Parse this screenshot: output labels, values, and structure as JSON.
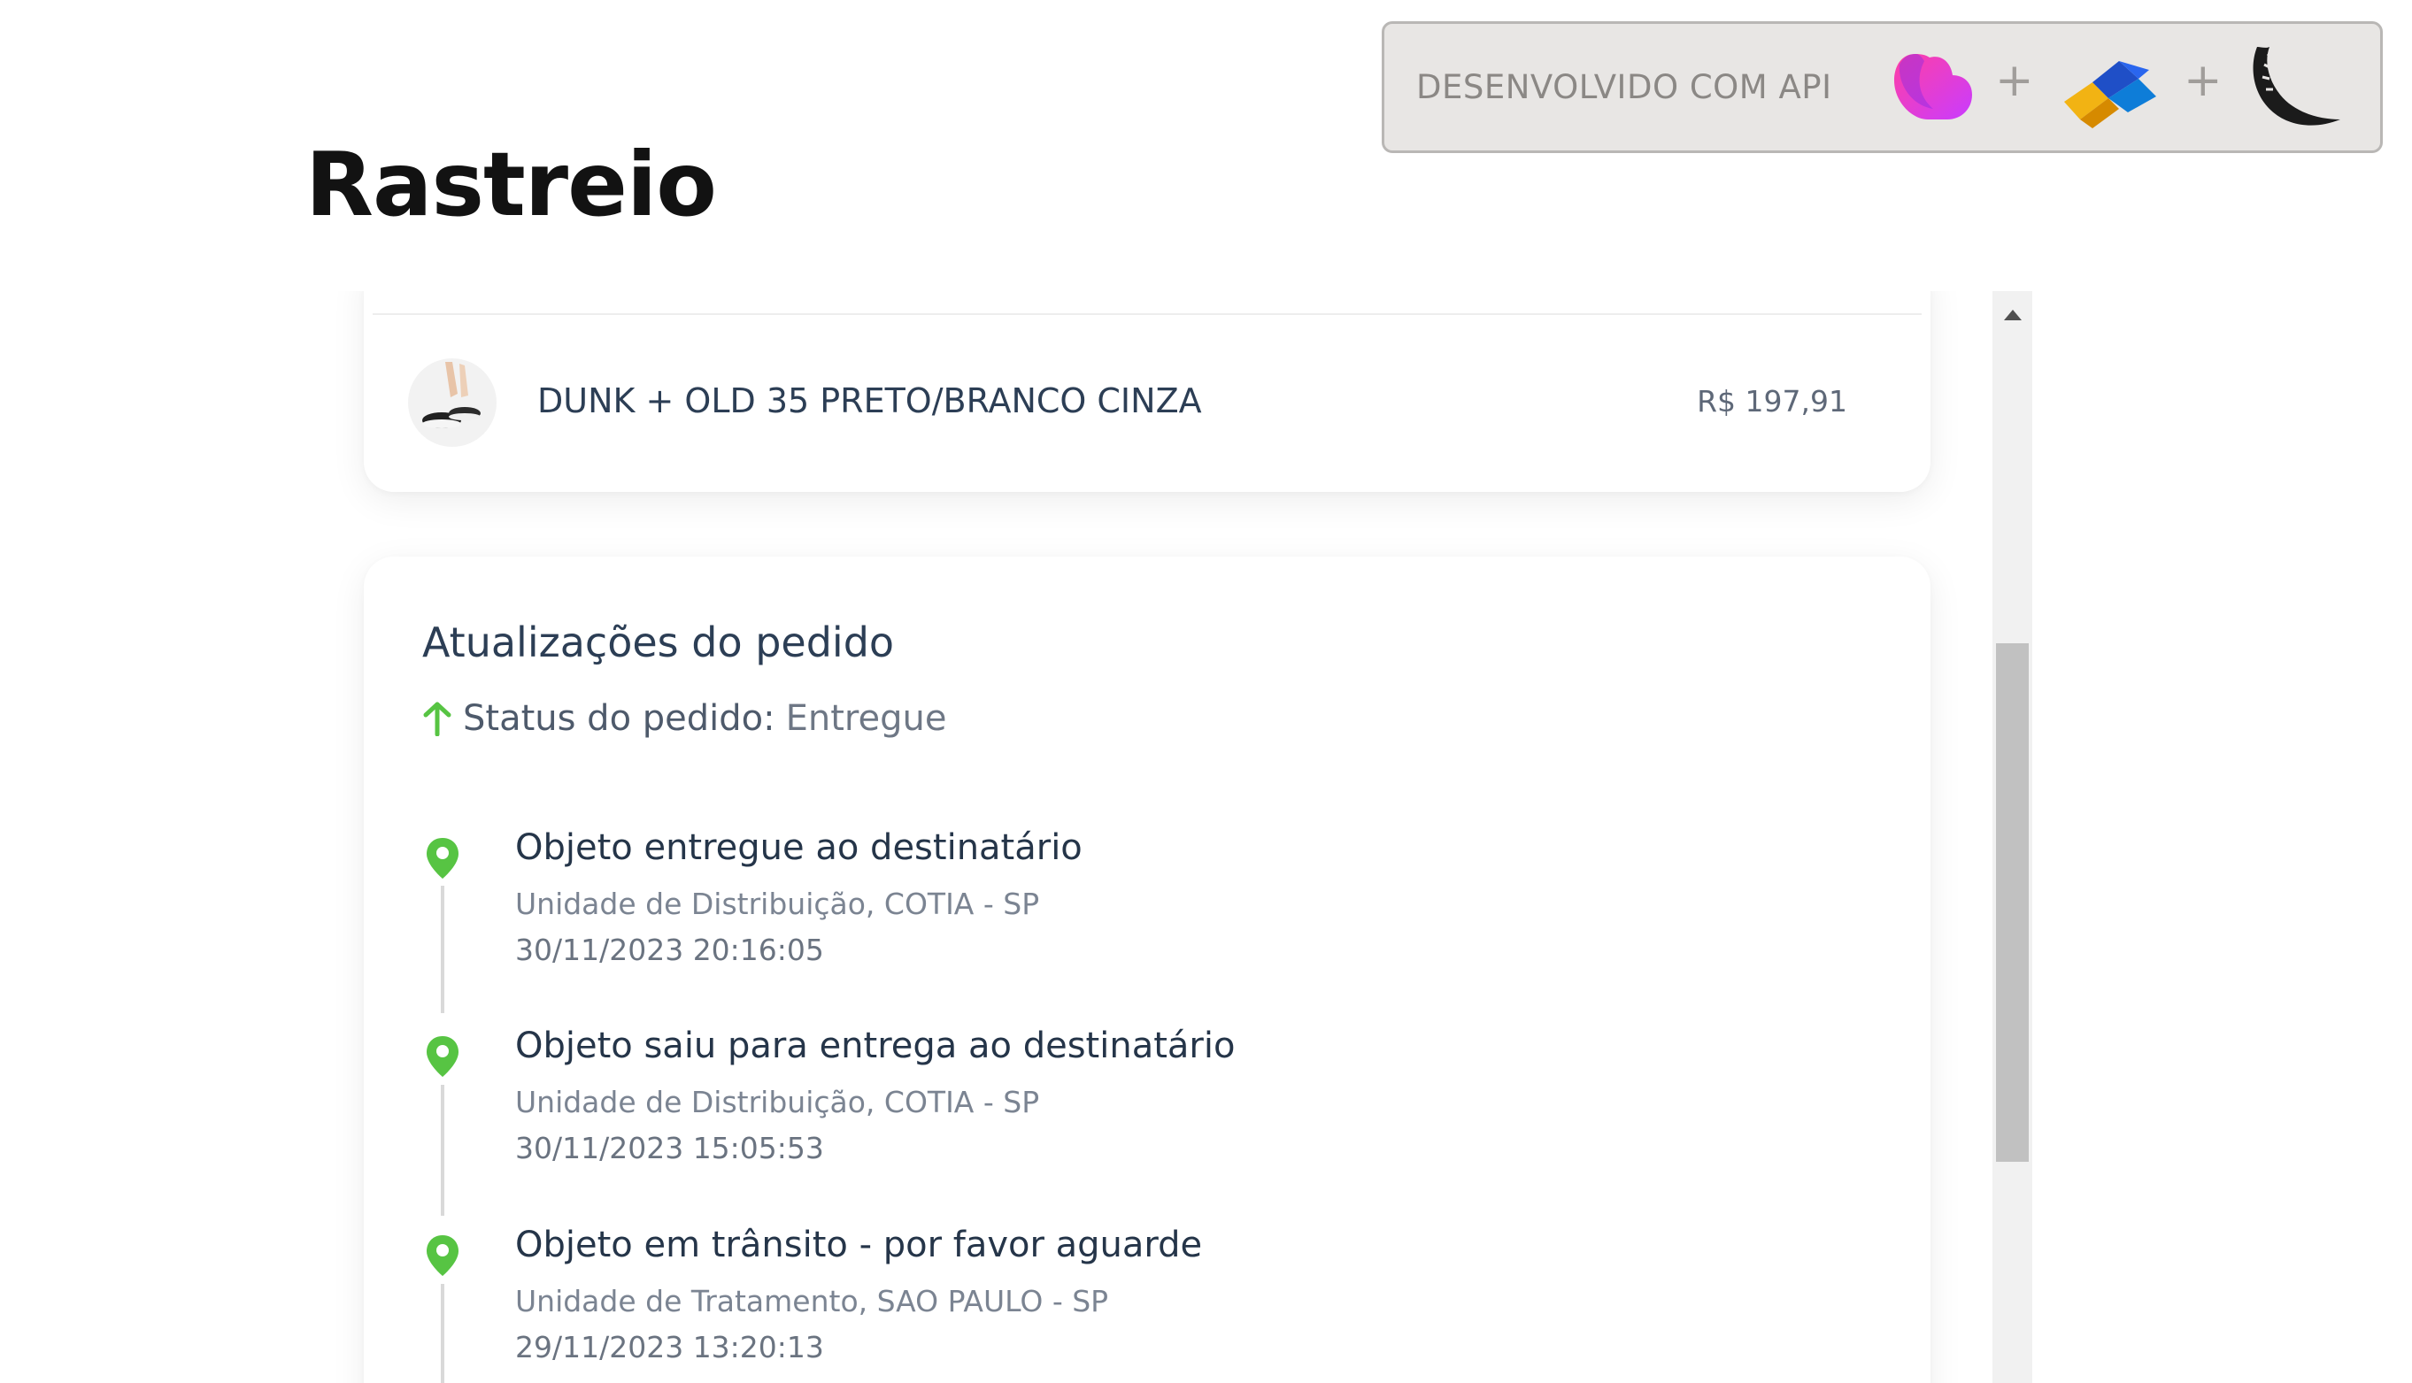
{
  "header": {
    "title": "Rastreio"
  },
  "api_banner": {
    "label": "DESENVOLVIDO COM API",
    "separator": "+",
    "logos": [
      "heart-logo-icon",
      "flag-logo-icon",
      "crescent-moon-logo-icon"
    ]
  },
  "product": {
    "name": "DUNK + OLD 35 PRETO/BRANCO CINZA",
    "price": "R$ 197,91"
  },
  "updates": {
    "title": "Atualizações do pedido",
    "status_label": "Status do pedido:",
    "status_value": "Entregue",
    "events": [
      {
        "title": "Objeto entregue ao destinatário",
        "location": "Unidade de Distribuição, COTIA - SP",
        "datetime": "30/11/2023 20:16:05"
      },
      {
        "title": "Objeto saiu para entrega ao destinatário",
        "location": "Unidade de Distribuição, COTIA - SP",
        "datetime": "30/11/2023 15:05:53"
      },
      {
        "title": "Objeto em trânsito - por favor aguarde",
        "location": "Unidade de Tratamento, SAO PAULO - SP",
        "datetime": "29/11/2023 13:20:13"
      }
    ]
  },
  "colors": {
    "accent_green": "#57c443",
    "title_text": "#2c3e55",
    "banner_bg": "#e8e6e4"
  }
}
